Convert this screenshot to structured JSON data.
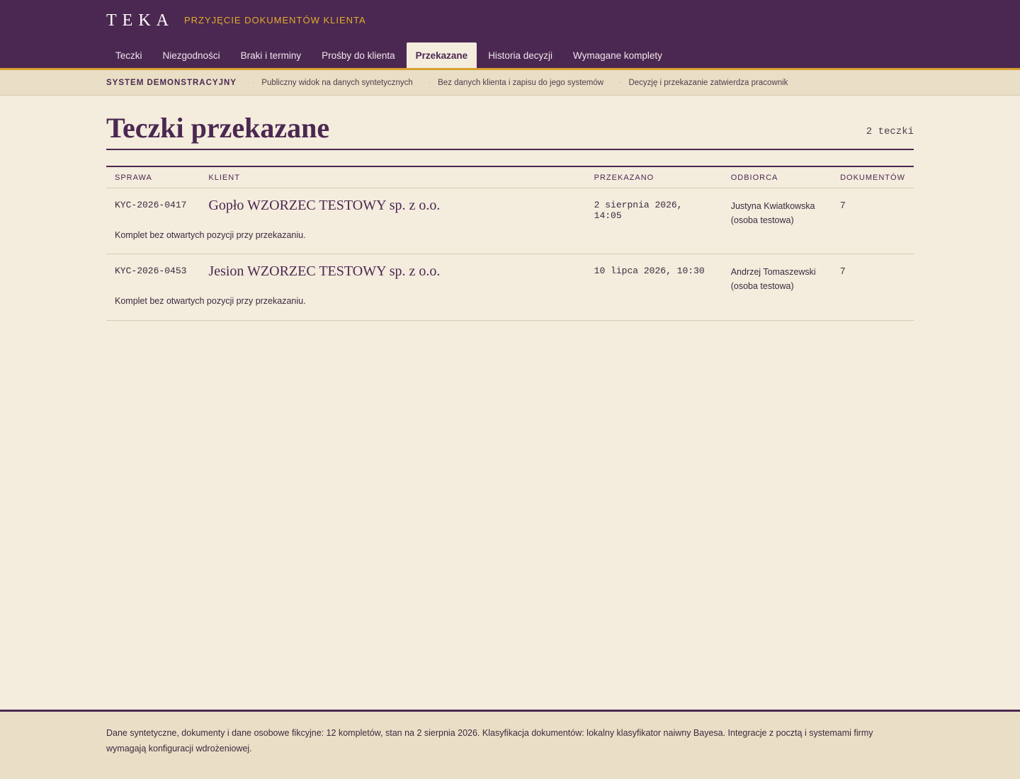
{
  "header": {
    "logo": "TEKA",
    "subtitle": "PRZYJĘCIE DOKUMENTÓW KLIENTA",
    "tabs": [
      {
        "label": "Teczki"
      },
      {
        "label": "Niezgodności"
      },
      {
        "label": "Braki i terminy"
      },
      {
        "label": "Prośby do klienta"
      },
      {
        "label": "Przekazane"
      },
      {
        "label": "Historia decyzji"
      },
      {
        "label": "Wymagane komplety"
      }
    ],
    "active_tab": "Przekazane"
  },
  "demo_strip": {
    "label": "SYSTEM DEMONSTRACYJNY",
    "items": [
      "Publiczny widok na danych syntetycznych",
      "Bez danych klienta i zapisu do jego systemów",
      "Decyzję i przekazanie zatwierdza pracownik"
    ]
  },
  "main": {
    "title": "Teczki przekazane",
    "count": "2 teczki",
    "columns": {
      "sprawa": "SPRAWA",
      "klient": "KLIENT",
      "przekazano": "PRZEKAZANO",
      "odbiorca": "ODBIORCA",
      "dokumentow": "DOKUMENTÓW"
    },
    "rows": [
      {
        "case_id": "KYC-2026-0417",
        "client": "Gopło WZORZEC TESTOWY sp. z o.o.",
        "transferred": "2 sierpnia 2026, 14:05",
        "recipient_name": "Justyna Kwiatkowska",
        "recipient_note": "(osoba testowa)",
        "documents": "7",
        "note": "Komplet bez otwartych pozycji przy przekazaniu."
      },
      {
        "case_id": "KYC-2026-0453",
        "client": "Jesion WZORZEC TESTOWY sp. z o.o.",
        "transferred": "10 lipca 2026, 10:30",
        "recipient_name": "Andrzej Tomaszewski",
        "recipient_note": "(osoba testowa)",
        "documents": "7",
        "note": "Komplet bez otwartych pozycji przy przekazaniu."
      }
    ]
  },
  "footer": {
    "text": "Dane syntetyczne, dokumenty i dane osobowe fikcyjne: 12 kompletów, stan na 2 sierpnia 2026. Klasyfikacja dokumentów: lokalny klasyfikator naiwny Bayesa. Integracje z pocztą i systemami firmy wymagają konfiguracji wdrożeniowej."
  },
  "colors": {
    "header_bg": "#4b2851",
    "accent": "#e3ac2f",
    "page_bg": "#f4ecdd",
    "strip_bg": "#e9dfc6"
  }
}
